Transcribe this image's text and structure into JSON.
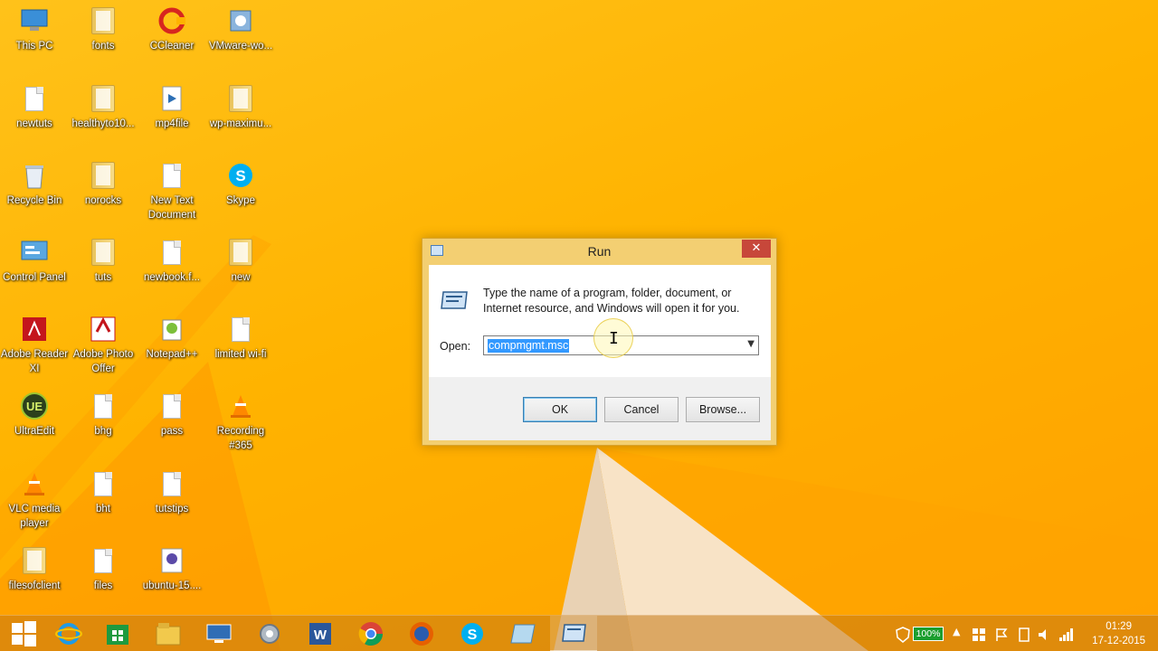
{
  "desktop_icons": [
    {
      "label": "This PC"
    },
    {
      "label": "fonts"
    },
    {
      "label": "CCleaner"
    },
    {
      "label": "VMware-wo..."
    },
    {
      "label": "newtuts"
    },
    {
      "label": "healthyto10..."
    },
    {
      "label": "mp4file"
    },
    {
      "label": "wp-maximu..."
    },
    {
      "label": "Recycle Bin"
    },
    {
      "label": "norocks"
    },
    {
      "label": "New Text Document"
    },
    {
      "label": "Skype"
    },
    {
      "label": "Control Panel"
    },
    {
      "label": "tuts"
    },
    {
      "label": "newbook.f..."
    },
    {
      "label": "new"
    },
    {
      "label": "Adobe Reader XI"
    },
    {
      "label": "Adobe Photo Offer"
    },
    {
      "label": "Notepad++"
    },
    {
      "label": "limited wi-fi"
    },
    {
      "label": "UltraEdit"
    },
    {
      "label": "bhg"
    },
    {
      "label": "pass"
    },
    {
      "label": "Recording #365"
    },
    {
      "label": "VLC media player"
    },
    {
      "label": "bht"
    },
    {
      "label": "tutstips"
    },
    {
      "label": "filesofclient"
    },
    {
      "label": "files"
    },
    {
      "label": "ubuntu-15...."
    }
  ],
  "run_dialog": {
    "title": "Run",
    "close_glyph": "✕",
    "description": "Type the name of a program, folder, document, or Internet resource, and Windows will open it for you.",
    "open_label": "Open:",
    "open_value": "compmgmt.msc",
    "ok_label": "OK",
    "cancel_label": "Cancel",
    "browse_label": "Browse..."
  },
  "taskbar": {
    "apps": [
      "start",
      "internet-explorer",
      "store",
      "file-explorer",
      "lenovo",
      "settings",
      "word",
      "chrome",
      "firefox",
      "skype",
      "notes",
      "run"
    ],
    "battery_text": "100%",
    "time": "01:29",
    "date": "17-12-2015"
  },
  "colors": {
    "wallpaper": "#ffb300",
    "selection": "#3399ff",
    "close": "#c7473a"
  }
}
